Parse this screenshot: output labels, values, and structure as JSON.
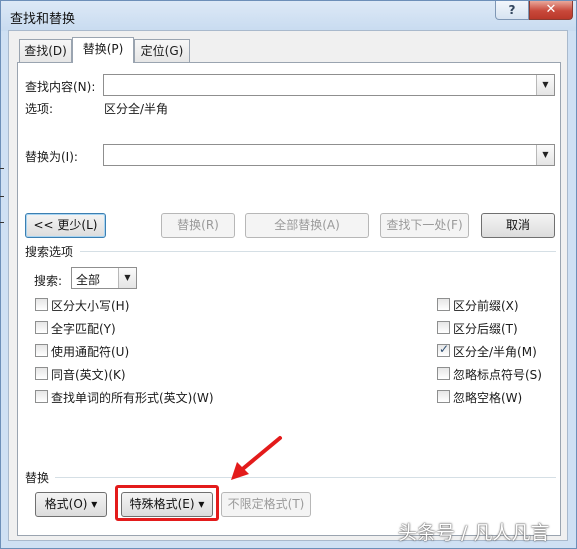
{
  "window": {
    "title": "查找和替换",
    "help_label": "?",
    "close_label": "✕"
  },
  "tabs": [
    {
      "label": "查找(D)",
      "active": false
    },
    {
      "label": "替换(P)",
      "active": true
    },
    {
      "label": "定位(G)",
      "active": false
    }
  ],
  "find": {
    "label": "查找内容(N):",
    "value": "",
    "options_label": "选项:",
    "options_value": "区分全/半角"
  },
  "replace": {
    "label": "替换为(I):",
    "value": ""
  },
  "buttons": {
    "less": "<< 更少(L)",
    "replace": "替换(R)",
    "replace_all": "全部替换(A)",
    "find_next": "查找下一处(F)",
    "cancel": "取消"
  },
  "search_options": {
    "group_label": "搜索选项",
    "search_label": "搜索:",
    "search_value": "全部",
    "left_checks": [
      {
        "label": "区分大小写(H)",
        "checked": false
      },
      {
        "label": "全字匹配(Y)",
        "checked": false
      },
      {
        "label": "使用通配符(U)",
        "checked": false
      },
      {
        "label": "同音(英文)(K)",
        "checked": false
      },
      {
        "label": "查找单词的所有形式(英文)(W)",
        "checked": false
      }
    ],
    "right_checks": [
      {
        "label": "区分前缀(X)",
        "checked": false
      },
      {
        "label": "区分后缀(T)",
        "checked": false
      },
      {
        "label": "区分全/半角(M)",
        "checked": true
      },
      {
        "label": "忽略标点符号(S)",
        "checked": false
      },
      {
        "label": "忽略空格(W)",
        "checked": false
      }
    ]
  },
  "replace_section": {
    "group_label": "替换",
    "format_button": "格式(O) ▾",
    "special_button": "特殊格式(E) ▾",
    "no_format_button": "不限定格式(T)"
  },
  "annotation": {
    "color": "#e31b1b"
  },
  "watermark": "头条号 / 凡人凡言",
  "check_mark": "✓",
  "dropdown_arrow": "▼"
}
